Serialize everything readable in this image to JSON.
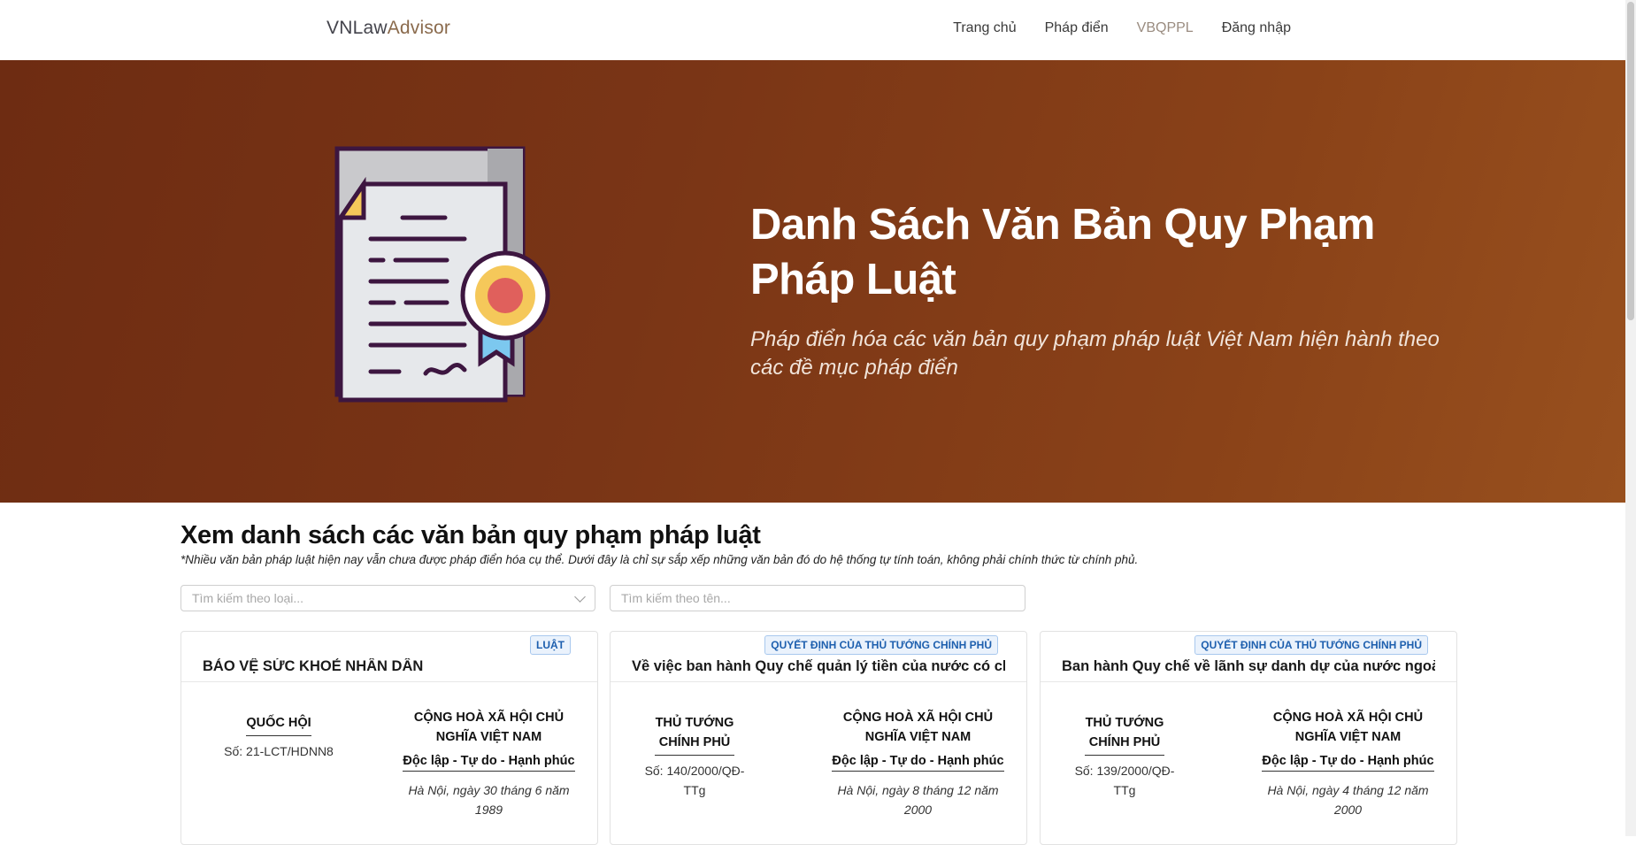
{
  "header": {
    "brand_part1": "VNLaw",
    "brand_part2": "Advisor",
    "nav": [
      "Trang chủ",
      "Pháp điển",
      "VBQPPL",
      "Đăng nhập"
    ]
  },
  "hero": {
    "title": "Danh Sách Văn Bản Quy Phạm Pháp Luật",
    "subtitle": "Pháp điển hóa các văn bản quy phạm pháp luật Việt Nam hiện hành theo các đề mục pháp điển",
    "icon": "certificate-document-icon"
  },
  "section": {
    "title": "Xem danh sách các văn bản quy phạm pháp luật",
    "note": "*Nhiều văn bản pháp luật hiện nay vẫn chưa được pháp điển hóa cụ thể. Dưới đây là chỉ sự sắp xếp những văn bản đó do hệ thống tự tính toán, không phải chính thức từ chính phủ."
  },
  "filters": {
    "type_placeholder": "Tìm kiếm theo loại...",
    "name_placeholder": "Tìm kiếm theo tên..."
  },
  "cards": [
    {
      "badge": "LUẬT",
      "title": "BẢO VỆ SỨC KHOẺ NHÂN DÂN",
      "issuer": "QUỐC HỘI",
      "number": "Số: 21-LCT/HDNN8",
      "republic": "CỘNG HOÀ XÃ HỘI CHỦ NGHĨA VIỆT NAM",
      "motto": "Độc lập - Tự do - Hạnh phúc",
      "date": "Hà Nội, ngày 30 tháng 6 năm 1989"
    },
    {
      "badge": "QUYẾT ĐỊNH CỦA THỦ TƯỚNG CHÍNH PHỦ",
      "title": "Về việc ban hành Quy chế quản lý tiền của nước có chung b",
      "issuer": "THỦ TƯỚNG CHÍNH PHỦ",
      "number": "Số: 140/2000/QĐ-TTg",
      "republic": "CỘNG HOÀ XÃ HỘI CHỦ NGHĨA VIỆT NAM",
      "motto": "Độc lập - Tự do - Hạnh phúc",
      "date": "Hà Nội, ngày 8 tháng 12 năm 2000"
    },
    {
      "badge": "QUYẾT ĐỊNH CỦA THỦ TƯỚNG CHÍNH PHỦ",
      "title": "Ban hành Quy chế về lãnh sự danh dự của nước ngoài tạiVi",
      "issuer": "THỦ TƯỚNG CHÍNH PHỦ",
      "number": "Số: 139/2000/QĐ-TTg",
      "republic": "CỘNG HOÀ XÃ HỘI CHỦ NGHĨA VIỆT NAM",
      "motto": "Độc lập - Tự do - Hạnh phúc",
      "date": "Hà Nội, ngày 4 tháng 12 năm 2000"
    }
  ]
}
